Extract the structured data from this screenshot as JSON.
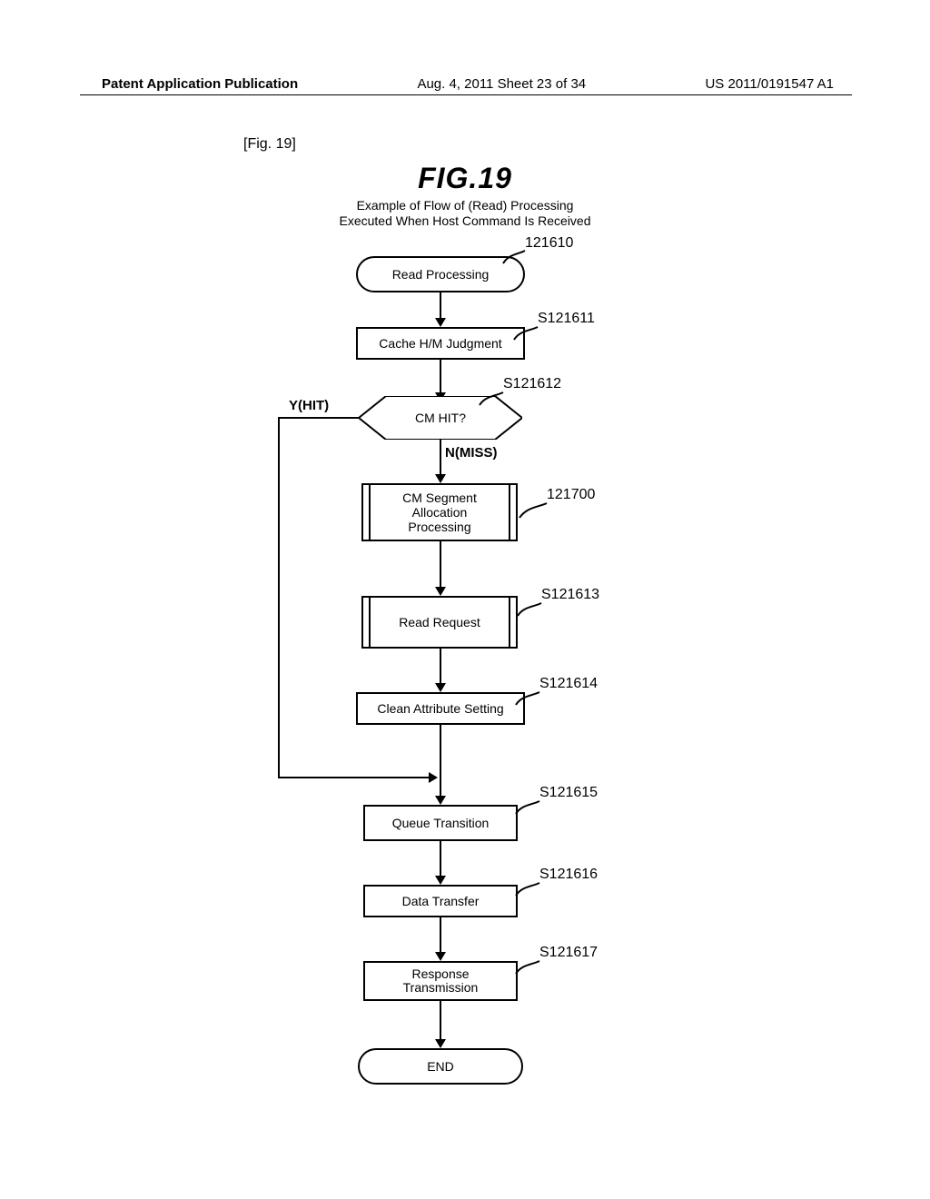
{
  "header": {
    "left": "Patent Application Publication",
    "mid": "Aug. 4, 2011  Sheet 23 of 34",
    "right": "US 2011/0191547 A1"
  },
  "fig": {
    "bracket": "[Fig. 19]",
    "title": "FIG.19",
    "subtitle_l1": "Example of Flow of (Read) Processing",
    "subtitle_l2": "Executed When Host Command Is Received"
  },
  "nodes": {
    "start": "Read Processing",
    "s1": "Cache H/M Judgment",
    "dec": "CM HIT?",
    "sub1_l1": "CM Segment",
    "sub1_l2": "Allocation",
    "sub1_l3": "Processing",
    "sub2": "Read Request",
    "s4": "Clean Attribute Setting",
    "s5": "Queue Transition",
    "s6": "Data Transfer",
    "s7_l1": "Response",
    "s7_l2": "Transmission",
    "end": "END"
  },
  "refs": {
    "r_start": "121610",
    "r_s1": "S121611",
    "r_dec": "S121612",
    "r_sub1": "121700",
    "r_sub2": "S121613",
    "r_s4": "S121614",
    "r_s5": "S121615",
    "r_s6": "S121616",
    "r_s7": "S121617"
  },
  "branches": {
    "yes": "Y(HIT)",
    "no": "N(MISS)"
  }
}
